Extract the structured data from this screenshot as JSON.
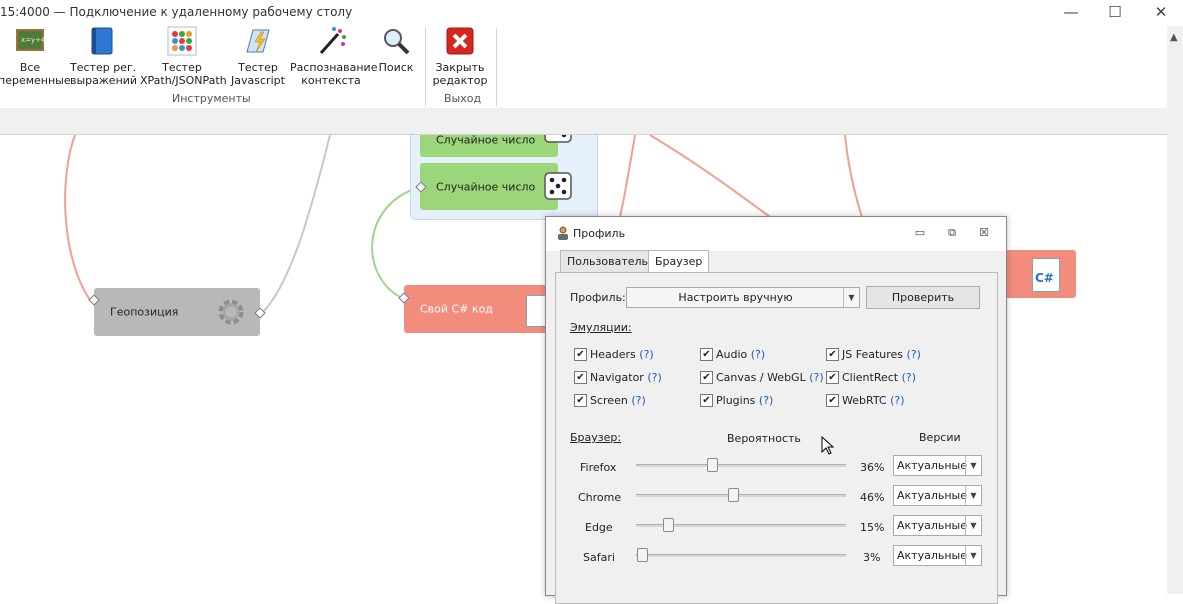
{
  "window": {
    "title": "15:4000 — Подключение к удаленному рабочему столу",
    "minimize": "—",
    "maximize": "☐",
    "close": "✕"
  },
  "ribbon": {
    "buttons": [
      {
        "line1": "Все",
        "line2": "переменные"
      },
      {
        "line1": "Тестер рег.",
        "line2": "выражений"
      },
      {
        "line1": "Тестер",
        "line2": "XPath/JSONPath"
      },
      {
        "line1": "Тестер",
        "line2": "Javascript"
      },
      {
        "line1": "Распознавание",
        "line2": "контекста"
      },
      {
        "line1": "Поиск",
        "line2": ""
      },
      {
        "line1": "Закрыть",
        "line2": "редактор"
      }
    ],
    "groups": {
      "tools": "Инструменты",
      "exit": "Выход"
    }
  },
  "canvas": {
    "nodes": {
      "random1": "Случайное число",
      "random2": "Случайное число",
      "geo": "Геопозиция",
      "csharp": "Свой C# код"
    },
    "icons": {
      "csharp_label": "C#"
    }
  },
  "dialog": {
    "title": "Профиль",
    "tabs": [
      "Пользователь",
      "Браузер"
    ],
    "active_tab": "Браузер",
    "profile_label": "Профиль:",
    "profile_value": "Настроить вручную",
    "check_button": "Проверить",
    "emulations_label": "Эмуляции:",
    "emulations": [
      {
        "label": "Headers",
        "help": "(?)",
        "checked": true
      },
      {
        "label": "Audio",
        "help": "(?)",
        "checked": true
      },
      {
        "label": "JS Features",
        "help": "(?)",
        "checked": true
      },
      {
        "label": "Navigator",
        "help": "(?)",
        "checked": true
      },
      {
        "label": "Canvas / WebGL",
        "help": "(?)",
        "checked": true
      },
      {
        "label": "ClientRect",
        "help": "(?)",
        "checked": true
      },
      {
        "label": "Screen",
        "help": "(?)",
        "checked": true
      },
      {
        "label": "Plugins",
        "help": "(?)",
        "checked": true
      },
      {
        "label": "WebRTC",
        "help": "(?)",
        "checked": true
      }
    ],
    "browser_label": "Браузер:",
    "probability_header": "Вероятность",
    "versions_header": "Версии",
    "browsers": [
      {
        "name": "Firefox",
        "percent": 36,
        "percent_text": "36%",
        "version": "Актуальные"
      },
      {
        "name": "Chrome",
        "percent": 46,
        "percent_text": "46%",
        "version": "Актуальные"
      },
      {
        "name": "Edge",
        "percent": 15,
        "percent_text": "15%",
        "version": "Актуальные"
      },
      {
        "name": "Safari",
        "percent": 3,
        "percent_text": "3%",
        "version": "Актуальные"
      }
    ]
  }
}
